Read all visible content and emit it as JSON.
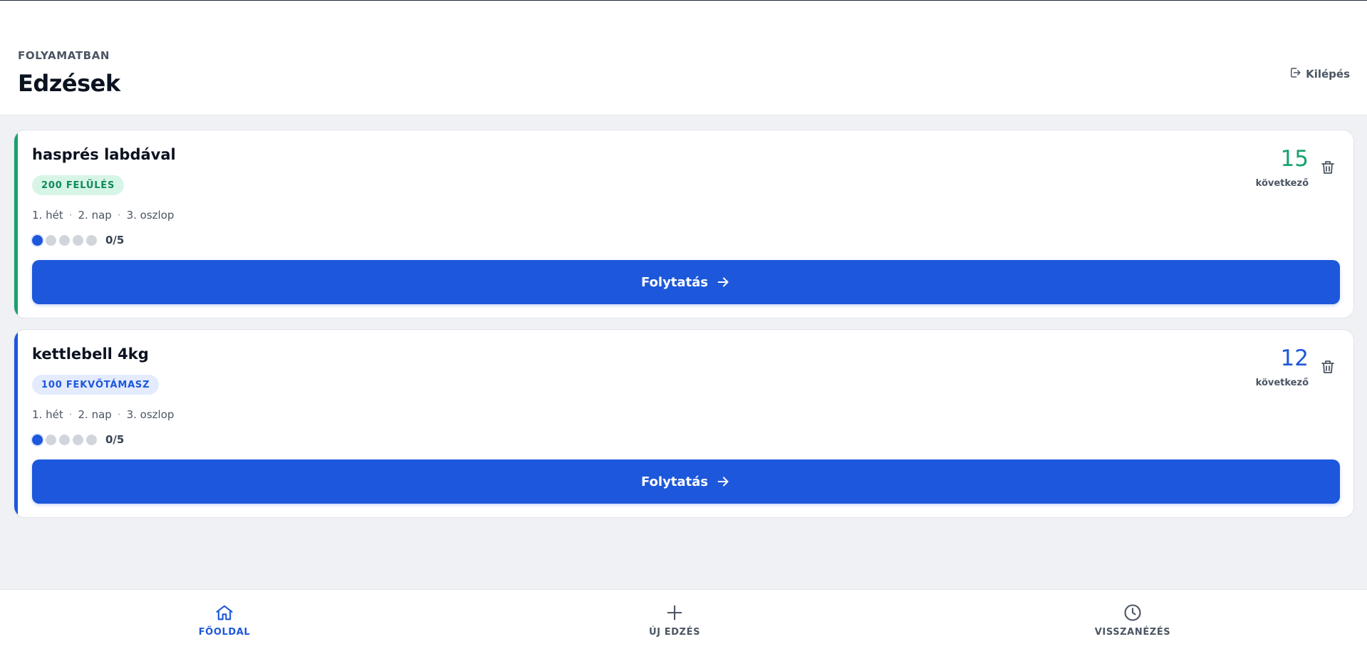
{
  "header": {
    "eyebrow": "FOLYAMATBAN",
    "title": "Edzések",
    "logout_label": "Kilépés"
  },
  "colors": {
    "primary": "#1d57db",
    "green": "#16a26b",
    "green_badge_bg": "#d7f5e7",
    "blue_badge_bg": "#e3ebfd"
  },
  "cards": [
    {
      "name": "hasprés labdával",
      "badge": "200 FELÜLÉS",
      "week": "1. hét",
      "day": "2. nap",
      "column": "3. oszlop",
      "progress_text": "0/5",
      "progress_done": 0,
      "progress_total": 5,
      "count": "15",
      "count_label": "következő",
      "cta_label": "Folytatás",
      "accent": "green"
    },
    {
      "name": "kettlebell 4kg",
      "badge": "100 FEKVŐTÁMASZ",
      "week": "1. hét",
      "day": "2. nap",
      "column": "3. oszlop",
      "progress_text": "0/5",
      "progress_done": 0,
      "progress_total": 5,
      "count": "12",
      "count_label": "következő",
      "cta_label": "Folytatás",
      "accent": "blue"
    }
  ],
  "nav": {
    "items": [
      {
        "label": "FŐOLDAL",
        "icon": "home-icon",
        "active": true
      },
      {
        "label": "ÚJ EDZÉS",
        "icon": "plus-icon",
        "active": false
      },
      {
        "label": "VISSZANÉZÉS",
        "icon": "clock-icon",
        "active": false
      }
    ]
  }
}
